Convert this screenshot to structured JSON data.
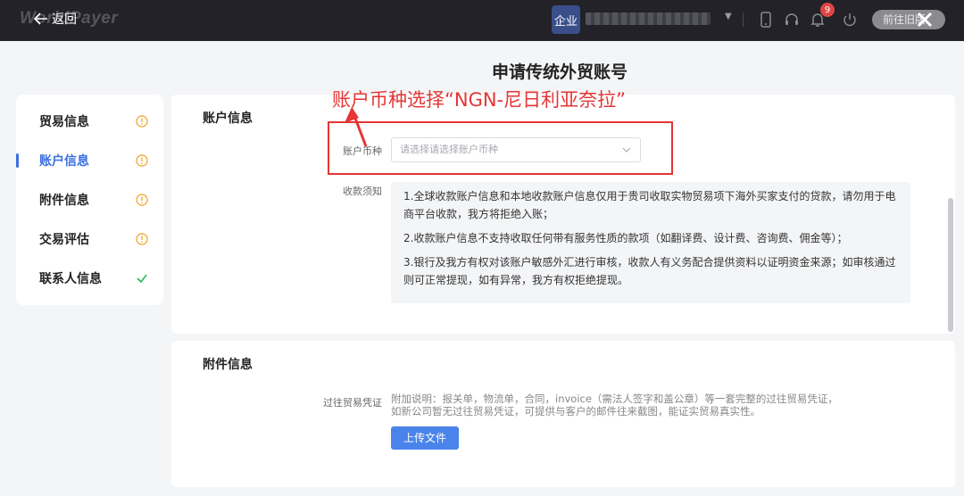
{
  "topbar": {
    "logo_text": "WorldPayer",
    "back_label": "返回",
    "enterprise_badge": "企业",
    "notification_count": "9",
    "goto_label": "前往旧版"
  },
  "page_title": "申请传统外贸账号",
  "sidebar": {
    "items": [
      {
        "label": "贸易信息",
        "status": "warning"
      },
      {
        "label": "账户信息",
        "status": "warning",
        "active": true
      },
      {
        "label": "附件信息",
        "status": "warning"
      },
      {
        "label": "交易评估",
        "status": "warning"
      },
      {
        "label": "联系人信息",
        "status": "done"
      }
    ]
  },
  "account_section": {
    "title": "账户信息",
    "currency_label": "账户币种",
    "currency_placeholder": "请选择请选择账户币种",
    "notice_label": "收款须知",
    "notices": [
      "1.全球收款账户信息和本地收款账户信息仅用于贵司收取实物贸易项下海外买家支付的贷款，请勿用于电商平台收款，我方将拒绝入账；",
      "2.收款账户信息不支持收取任何带有服务性质的款项（如翻译费、设计费、咨询费、佣金等）；",
      "3.银行及我方有权对该账户敏感外汇进行审核，收款人有义务配合提供资料以证明资金来源；如审核通过则可正常提现，如有异常，我方有权拒绝提现。"
    ]
  },
  "attachment_section": {
    "title": "附件信息",
    "voucher_label": "过往贸易凭证",
    "hint_line1": "附加说明：报关单，物流单，合同，invoice（需法人签字和盖公章）等一套完整的过往贸易凭证，",
    "hint_line2": "如新公司暂无过往贸易凭证，可提供与客户的邮件往来截图，能证实贸易真实性。",
    "upload_label": "上传文件"
  },
  "annotation": {
    "text": "账户币种选择“NGN-尼日利亚奈拉”",
    "color": "#e53535"
  },
  "colors": {
    "accent": "#3a6fe0",
    "warning": "#f0a020",
    "success": "#2bb85a"
  }
}
